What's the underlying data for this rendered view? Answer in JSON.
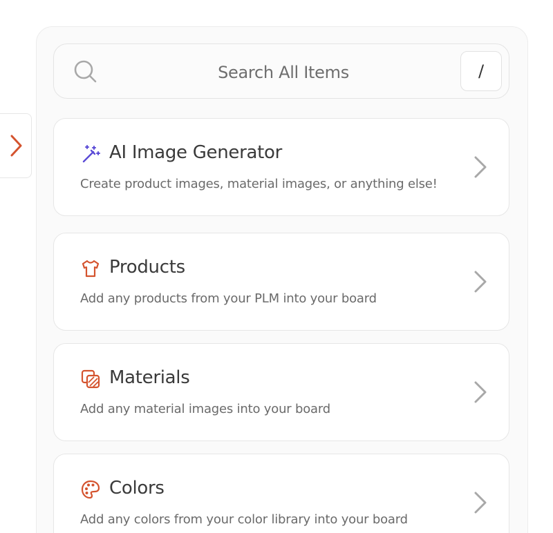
{
  "search": {
    "placeholder": "Search All Items",
    "shortcut_key": "/"
  },
  "items": [
    {
      "title": "AI Image Generator",
      "description": "Create product images, material images, or anything else!",
      "icon": "magic-wand-icon",
      "icon_color": "#5b4bd6"
    },
    {
      "title": "Products",
      "description": "Add any products from your PLM into your board",
      "icon": "tshirt-icon",
      "icon_color": "#d4532e"
    },
    {
      "title": "Materials",
      "description": "Add any material images into your board",
      "icon": "material-swatch-icon",
      "icon_color": "#d4532e"
    },
    {
      "title": "Colors",
      "description": "Add any colors from your color library into your board",
      "icon": "palette-icon",
      "icon_color": "#d4532e"
    }
  ],
  "colors": {
    "accent": "#d4532e",
    "ai_accent": "#5b4bd6",
    "chevron": "#a8a8a8"
  }
}
